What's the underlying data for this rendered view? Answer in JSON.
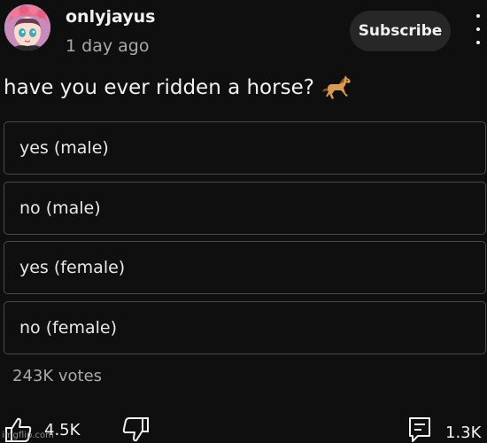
{
  "header": {
    "channel_name": "onlyjayus",
    "posted_time": "1 day ago",
    "subscribe_label": "Subscribe",
    "avatar_icon": "anime-avatar-icon",
    "more_icon": "more-vert-icon"
  },
  "post": {
    "question": "have you ever ridden a horse?",
    "emoji_icon": "horse-emoji-icon"
  },
  "poll": {
    "options": [
      {
        "label": "yes (male)"
      },
      {
        "label": "no (male)"
      },
      {
        "label": "yes (female)"
      },
      {
        "label": "no (female)"
      }
    ],
    "votes_label": "243K votes"
  },
  "actions": {
    "like_count": "4.5K",
    "comment_count": "1.3K",
    "like_icon": "thumbs-up-icon",
    "dislike_icon": "thumbs-down-icon",
    "comment_icon": "comment-icon"
  },
  "watermark": "imgflip.com",
  "colors": {
    "background": "#0f0f0f",
    "button_bg": "#272727",
    "option_border": "#4a4a4a",
    "secondary_text": "#aaaaaa"
  }
}
